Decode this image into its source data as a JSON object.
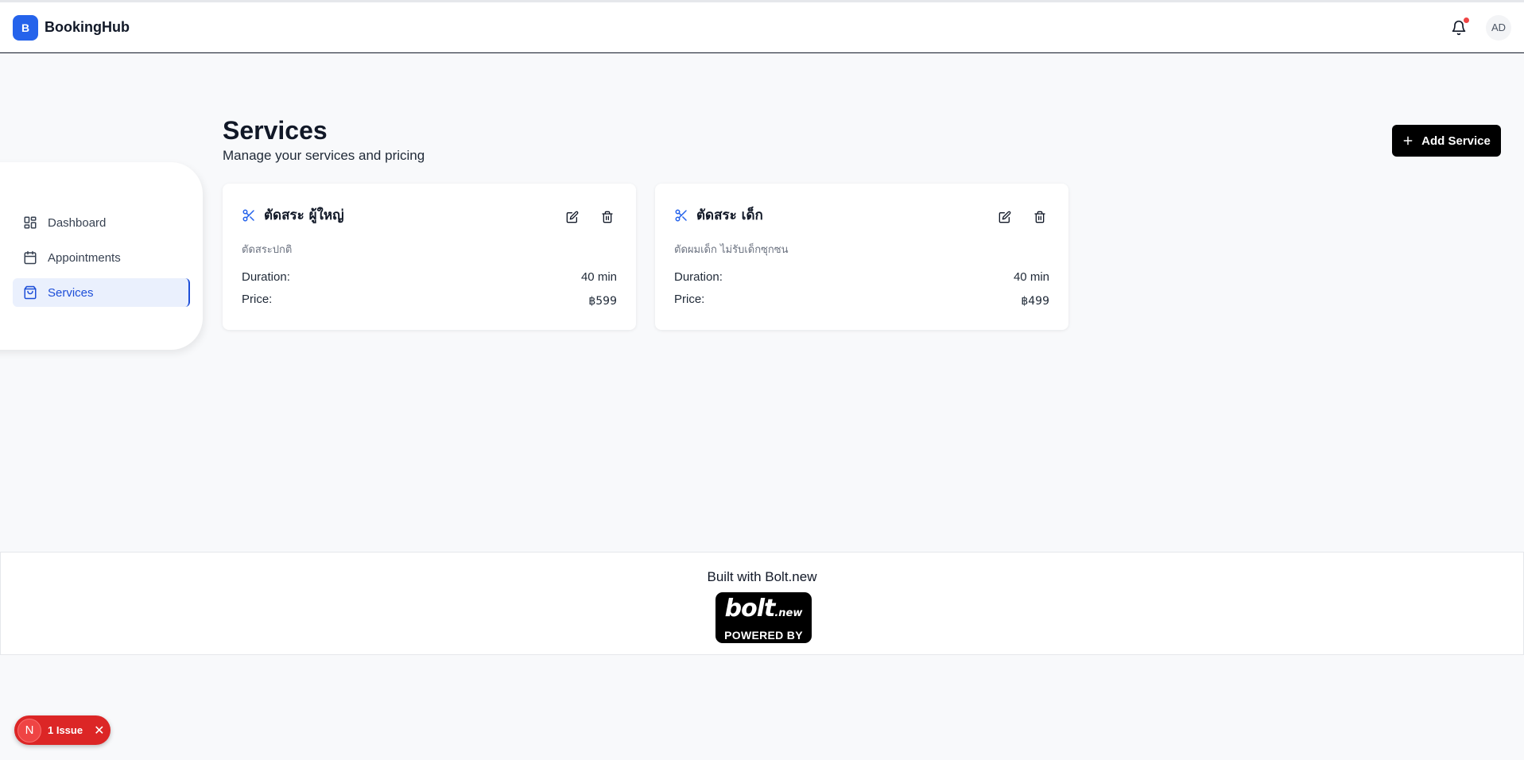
{
  "header": {
    "logo_letter": "B",
    "brand": "BookingHub",
    "avatar_initials": "AD"
  },
  "sidebar": {
    "items": [
      {
        "label": "Dashboard",
        "icon": "layout-grid-icon",
        "active": false
      },
      {
        "label": "Appointments",
        "icon": "calendar-icon",
        "active": false
      },
      {
        "label": "Services",
        "icon": "shopping-bag-icon",
        "active": true
      }
    ]
  },
  "main": {
    "title": "Services",
    "subtitle": "Manage your services and pricing",
    "add_button_label": "Add Service",
    "duration_label": "Duration:",
    "price_label": "Price:",
    "services": [
      {
        "name": "ตัดสระ ผู้ใหญ่",
        "description": "ตัดสระปกติ",
        "duration": "40 min",
        "price": "฿599"
      },
      {
        "name": "ตัดสระ เด็ก",
        "description": "ตัดผมเด็ก ไม่รับเด็กซุกซน",
        "duration": "40 min",
        "price": "฿499"
      }
    ]
  },
  "footer": {
    "built_with": "Built with Bolt.new",
    "badge_word": "bolt",
    "badge_suffix": ".new",
    "badge_sub": "POWERED BY"
  },
  "issue_badge": {
    "letter": "N",
    "text": "1 Issue"
  },
  "colors": {
    "accent": "#2563eb",
    "active_bg": "#eaf0fd",
    "notification_dot": "#ef4444",
    "issue_pill": "#dc2626"
  }
}
